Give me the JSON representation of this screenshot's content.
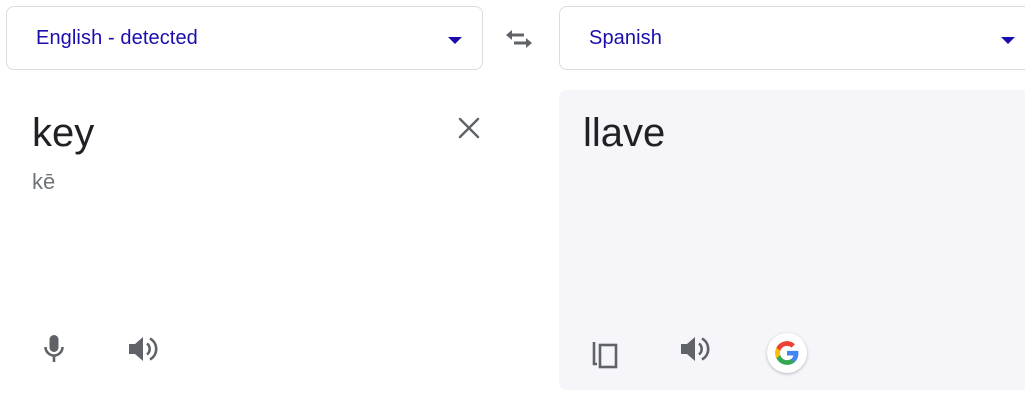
{
  "source": {
    "language_label": "English - detected",
    "text": "key",
    "phonetic": "kē"
  },
  "target": {
    "language_label": "Spanish",
    "text": "llave"
  },
  "icons": {
    "swap": "swap-arrows-icon",
    "clear": "close-icon",
    "mic": "microphone-icon",
    "speaker": "speaker-icon",
    "copy": "copy-icon",
    "google": "google-logo-icon"
  },
  "colors": {
    "language_link": "#1a0dab",
    "text": "#202124",
    "secondary_text": "#70757a",
    "icon": "#5f6368",
    "target_background": "#f5f5fa"
  }
}
